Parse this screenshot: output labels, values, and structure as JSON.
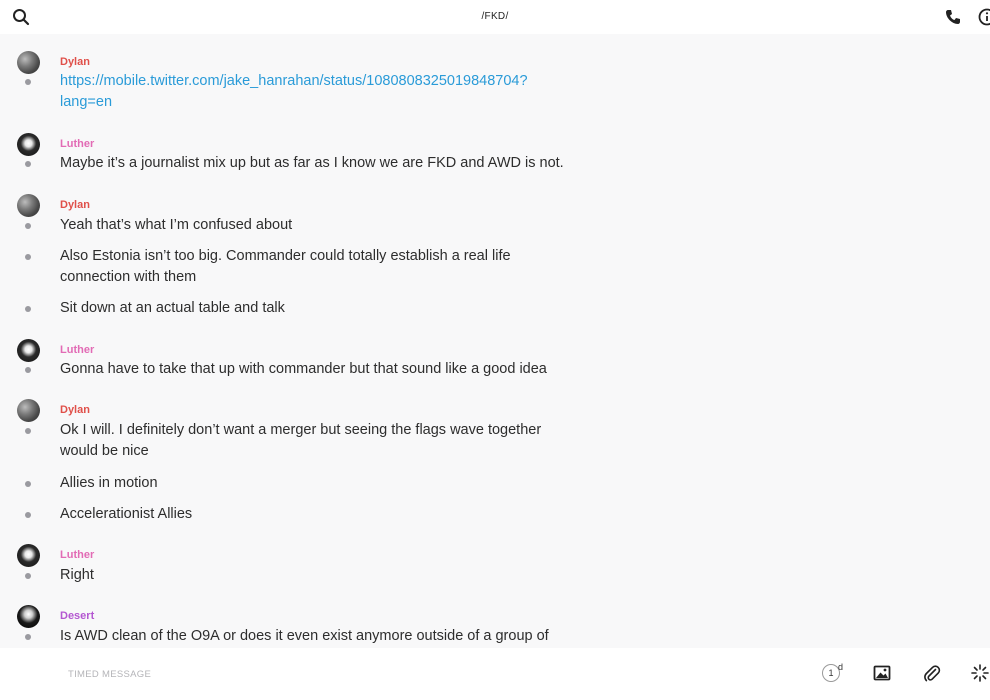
{
  "header": {
    "title": "/FKD/",
    "search_icon": "search-icon",
    "call_icon": "phone-icon",
    "info_icon": "info-icon"
  },
  "colors": {
    "dylan": "#e0504a",
    "luther": "#e26bb5",
    "desert": "#b457d1",
    "link": "#2a9bd8"
  },
  "messages": [
    {
      "sender": "Dylan",
      "lines": [
        "https://mobile.twitter.com/jake_hanrahan/status/1080808325019848704?\nlang=en"
      ]
    },
    {
      "sender": "Luther",
      "lines": [
        "Maybe it’s a journalist mix up but as far as I know we are FKD and AWD is not."
      ]
    },
    {
      "sender": "Dylan",
      "lines": [
        "Yeah that’s what I’m confused about",
        "Also Estonia isn’t too big. Commander could totally establish a real life connection with them",
        "Sit down at an actual table and talk"
      ]
    },
    {
      "sender": "Luther",
      "lines": [
        "Gonna have to take that up with commander but that sound like a good idea"
      ]
    },
    {
      "sender": "Dylan",
      "lines": [
        "Ok I will. I definitely don’t want a merger but seeing the flags wave together would be nice",
        "Allies in motion",
        "Accelerationist Allies"
      ]
    },
    {
      "sender": "Luther",
      "lines": [
        "Right"
      ]
    },
    {
      "sender": "Desert",
      "lines": [
        "Is AWD clean of the O9A or does it even exist anymore outside of a group of"
      ]
    }
  ],
  "composer": {
    "placeholder": "TIMED MESSAGE",
    "timer_value": "1",
    "timer_unit": "d",
    "image_icon": "image-icon",
    "attach_icon": "paperclip-icon",
    "more_icon": "sparkle-icon"
  }
}
